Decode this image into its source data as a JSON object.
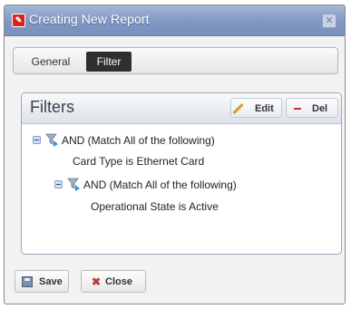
{
  "window": {
    "title": "Creating New Report"
  },
  "tabs": [
    {
      "label": "General",
      "active": false
    },
    {
      "label": "Filter",
      "active": true
    }
  ],
  "filters": {
    "title": "Filters",
    "edit_label": "Edit",
    "del_label": "Del",
    "tree": [
      {
        "text": "AND (Match All of the following)",
        "type": "group"
      },
      {
        "text": "Card Type is Ethernet Card",
        "type": "condition"
      },
      {
        "text": "AND (Match All of the following)",
        "type": "group"
      },
      {
        "text": "Operational State is Active",
        "type": "condition"
      }
    ]
  },
  "footer": {
    "save_label": "Save",
    "close_label": "Close"
  },
  "colors": {
    "titlebar": "#7f97c2",
    "active_tab": "#2f2f2f",
    "panel_border": "#9aa6bb"
  }
}
